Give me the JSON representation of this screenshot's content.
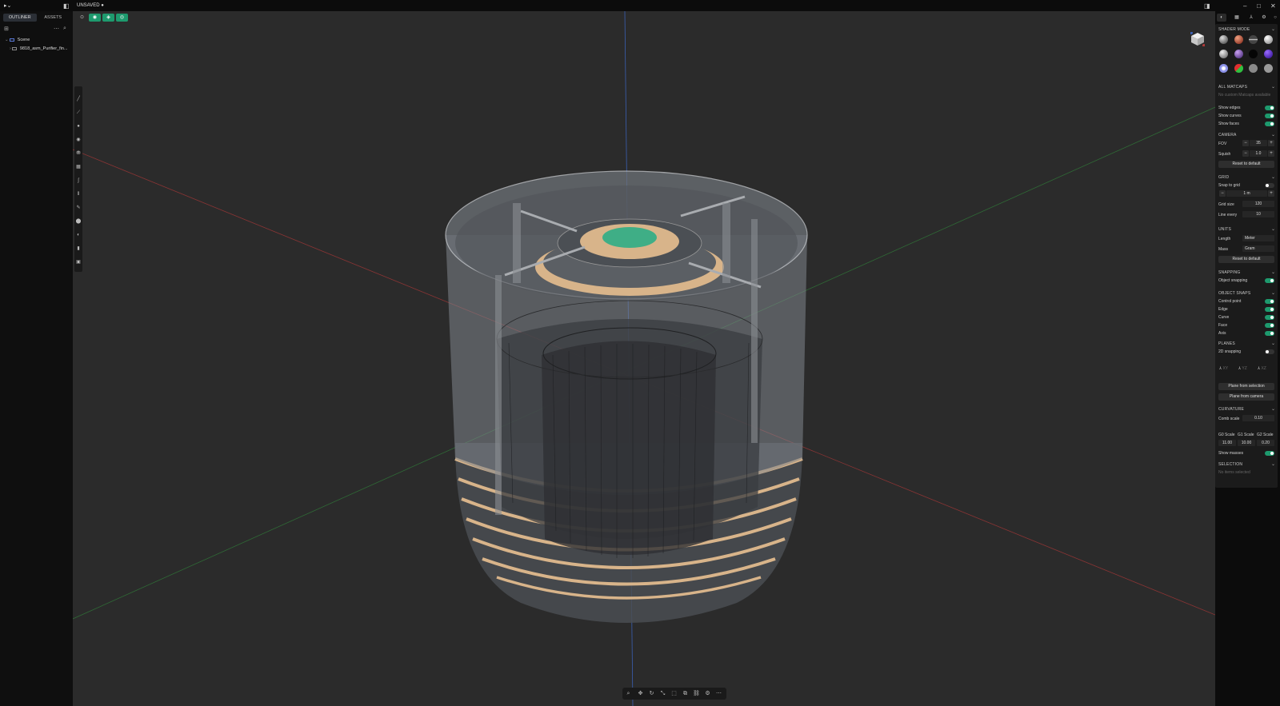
{
  "titlebar": {
    "document_title": "UNSAVED"
  },
  "outliner": {
    "tabs": [
      "OUTLINER",
      "ASSETS"
    ],
    "scene_label": "Scene",
    "item_label": "9818_asm_Purifier_fin..."
  },
  "right_panel": {
    "shader_mode": {
      "title": "SHADER MODE"
    },
    "matcaps": {
      "title": "ALL MATCAPS",
      "empty_text": "No custom Matcaps available"
    },
    "show": {
      "edges": "Show edges",
      "curves": "Show curves",
      "faces": "Show faces"
    },
    "camera": {
      "title": "CAMERA",
      "fov_label": "FOV",
      "fov_value": "35",
      "squish_label": "Squish",
      "squish_value": "1.0",
      "reset_label": "Reset to default"
    },
    "grid": {
      "title": "GRID",
      "snap_label": "Snap to grid",
      "step_value": "1 m",
      "size_label": "Grid size",
      "size_value": "120",
      "line_label": "Line every",
      "line_value": "10"
    },
    "units": {
      "title": "UNITS",
      "length_label": "Length",
      "length_value": "Meter",
      "mass_label": "Mass",
      "mass_value": "Gram",
      "reset_label": "Reset to default"
    },
    "snapping": {
      "title": "SNAPPING",
      "object_label": "Object snapping"
    },
    "object_snaps": {
      "title": "OBJECT SNAPS",
      "control_point": "Control point",
      "edge": "Edge",
      "curve": "Curve",
      "face": "Face",
      "axis": "Axis"
    },
    "planes": {
      "title": "PLANES",
      "snap2d_label": "2D snapping",
      "xy": "XY",
      "yz": "YZ",
      "xz": "XZ",
      "from_selection": "Plane from selection",
      "from_camera": "Plane from camera"
    },
    "curvature": {
      "title": "CURVATURE",
      "comb_label": "Comb scale",
      "comb_value": "0.10",
      "g0_label": "G0 Scale",
      "g1_label": "G1 Scale",
      "g2_label": "G2 Scale",
      "g0_value": "11.00",
      "g1_value": "10.00",
      "g2_value": "0.20",
      "show_masses": "Show masses"
    },
    "selection": {
      "title": "SELECTION",
      "empty_text": "No items selected"
    }
  },
  "colors": {
    "accent": "#1e9a6e",
    "viewport_bg": "#2b2b2b",
    "axis_x": "#b23a3a",
    "axis_y": "#2f7a3a",
    "axis_z": "#3a5fb2",
    "wood": "#d8b48a",
    "green_part": "#3fae86"
  }
}
